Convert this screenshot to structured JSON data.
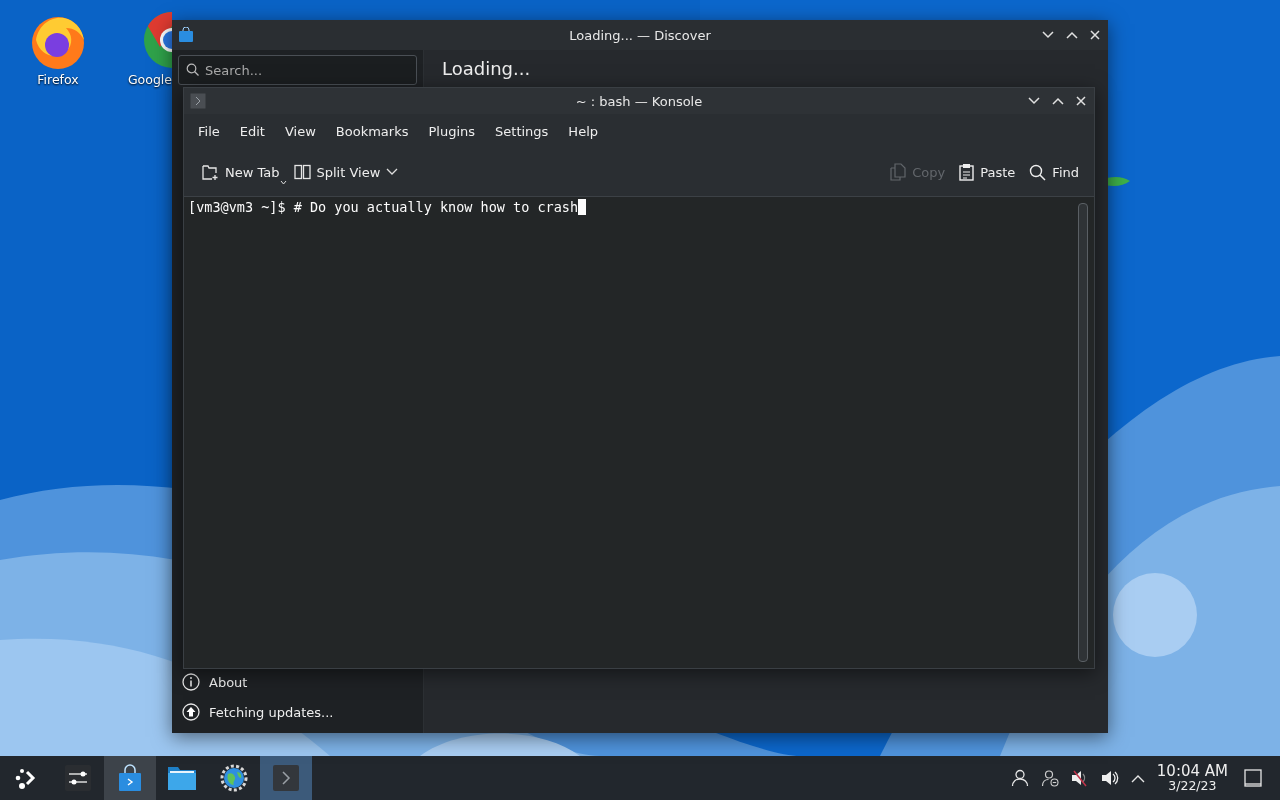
{
  "desktop": {
    "icons": [
      {
        "label": "Firefox",
        "kind": "firefox"
      },
      {
        "label": "Google",
        "kind": "chrome"
      }
    ]
  },
  "discover": {
    "title": "Loading... — Discover",
    "search": {
      "placeholder": "Search..."
    },
    "heading": "Loading...",
    "sidebar_footer": [
      {
        "label": "About",
        "kind": "info"
      },
      {
        "label": "Fetching updates...",
        "kind": "update"
      }
    ]
  },
  "konsole": {
    "title": "~ : bash — Konsole",
    "menu": [
      "File",
      "Edit",
      "View",
      "Bookmarks",
      "Plugins",
      "Settings",
      "Help"
    ],
    "toolbar_left": [
      {
        "label": "New Tab",
        "kind": "new-tab",
        "disabled": false
      },
      {
        "label": "Split View",
        "kind": "split-view",
        "disabled": false
      }
    ],
    "toolbar_right": [
      {
        "label": "Copy",
        "kind": "copy",
        "disabled": true
      },
      {
        "label": "Paste",
        "kind": "paste",
        "disabled": false
      },
      {
        "label": "Find",
        "kind": "find",
        "disabled": false
      }
    ],
    "terminal": {
      "prompt": "[vm3@vm3 ~]$ # Do you actually know how to crash"
    }
  },
  "taskbar": {
    "tasks": [
      {
        "kind": "mixer",
        "running": false,
        "selected": false
      },
      {
        "kind": "discover",
        "running": true,
        "selected": false
      },
      {
        "kind": "files",
        "running": false,
        "selected": false
      },
      {
        "kind": "settings",
        "running": false,
        "selected": false
      },
      {
        "kind": "konsole",
        "running": true,
        "selected": true
      }
    ],
    "tray": [
      {
        "kind": "user"
      },
      {
        "kind": "user-away"
      },
      {
        "kind": "muted"
      },
      {
        "kind": "volume"
      },
      {
        "kind": "expand"
      }
    ],
    "clock": {
      "time": "10:04 AM",
      "date": "3/22/23"
    }
  }
}
